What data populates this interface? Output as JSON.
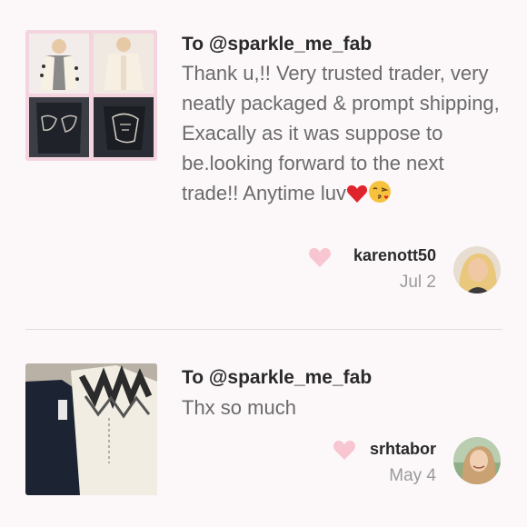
{
  "feedback": [
    {
      "to": "To @sparkle_me_fab",
      "message": "Thank u,!! Very trusted trader, very neatly packaged & prompt shipping, Exacally as it was suppose to be.looking forward to the next trade!! Anytime luv",
      "emojis": [
        "heart-emoji",
        "kissing-face-emoji"
      ],
      "username": "karenott50",
      "date": "Jul 2"
    },
    {
      "to": "To @sparkle_me_fab",
      "message": "Thx so much",
      "username": "srhtabor",
      "date": "May 4"
    }
  ],
  "colors": {
    "background": "#fcf8fa",
    "heart": "#f7c6d0",
    "text_primary": "#2a2a2a",
    "text_secondary": "#6b6b6b",
    "text_muted": "#9a9a9a"
  }
}
